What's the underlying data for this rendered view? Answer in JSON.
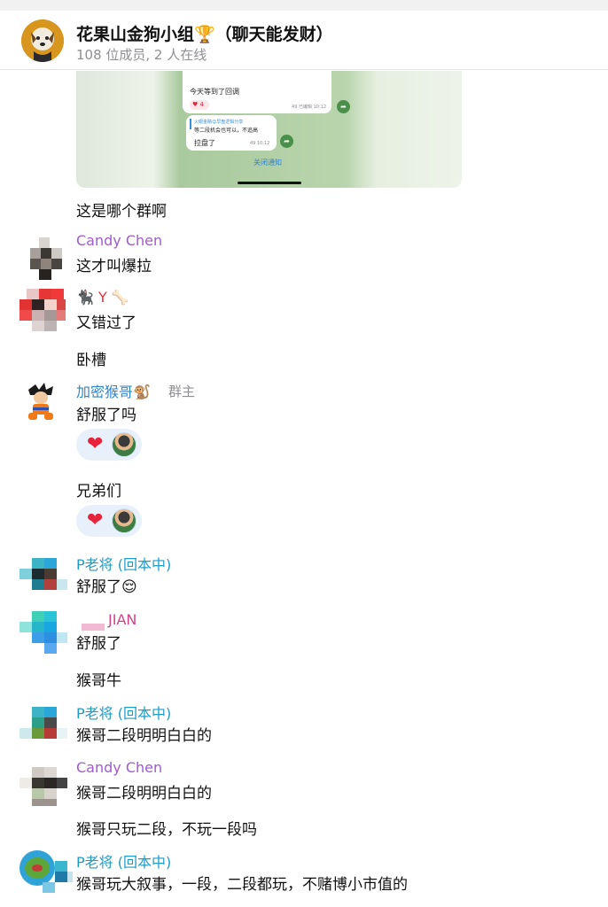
{
  "header": {
    "title": "花果山金狗小组🏆（聊天能发财）",
    "subtitle": "108 位成员, 2 人在线",
    "avatar_icon": "dog-avatar-icon"
  },
  "screenshot": {
    "line1": "今天等到了回调",
    "reaction_count": "4",
    "meta1": "49 已编辑 10:12",
    "quote_author": "火眼金睛😊早盘逻辑分享",
    "line2": "等二段机会也可以，不追高",
    "line3": "拉盘了",
    "meta2": "49 10:12",
    "close_label": "关闭通知"
  },
  "messages": {
    "m1": {
      "text": "这是哪个群啊"
    },
    "m2": {
      "sender": "Candy Chen",
      "text": "这才叫爆拉",
      "color": "#a05bd0"
    },
    "m3": {
      "sender": "🐈‍⬛ Y 🦴",
      "text": "又错过了",
      "color": "#e0323f"
    },
    "m4": {
      "text": "卧槽"
    },
    "m5": {
      "sender": "加密猴哥🐒",
      "role": "群主",
      "text": "舒服了吗",
      "color": "#2d86c9"
    },
    "m6": {
      "text": "兄弟们"
    },
    "m7": {
      "sender": "P老将 (回本中)",
      "text": "舒服了😌",
      "color": "#1e9cc7"
    },
    "m8": {
      "sender": "JIAN",
      "text": "舒服了",
      "color": "#d2448a"
    },
    "m9": {
      "text": "猴哥牛"
    },
    "m10": {
      "sender": "P老将 (回本中)",
      "text": "猴哥二段明明白白的",
      "color": "#1e9cc7"
    },
    "m11": {
      "sender": "Candy Chen",
      "text": "猴哥二段明明白白的",
      "color": "#a05bd0"
    },
    "m12": {
      "text": "猴哥只玩二段，不玩一段吗"
    },
    "m13": {
      "sender": "P老将 (回本中)",
      "text": "猴哥玩大叙事，一段，二段都玩，不赌博小市值的",
      "color": "#1e9cc7"
    }
  },
  "reactions": {
    "r1": {
      "emoji": "❤",
      "avatar_icon": "vegeta-avatar-icon"
    },
    "r2": {
      "emoji": "❤",
      "avatar_icon": "vegeta-avatar-icon"
    }
  },
  "colors": {
    "accent_blue": "#2d86c9",
    "reaction_bg": "#e8f1fb",
    "heart": "#e5243b"
  }
}
